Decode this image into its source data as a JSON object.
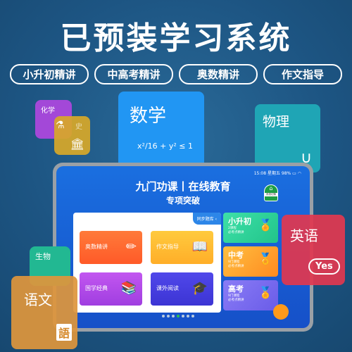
{
  "headline": "已预装学习系统",
  "pills": [
    "小升初精讲",
    "中高考精讲",
    "奥数精讲",
    "作文指导"
  ],
  "subjects": {
    "chemistry": "化学",
    "history": "史",
    "math": "数学",
    "math_formula": "x²/16 + y² ≤ 1",
    "physics": "物理",
    "english": "英语",
    "english_badge": "Yes",
    "biology": "生物",
    "chinese": "语文",
    "chinese_icon_char": "語"
  },
  "tablet": {
    "status": {
      "time": "15:08",
      "weekday": "星期五",
      "battery": "98%"
    },
    "title": "九门功课丨在线教育",
    "subtitle": "专项突破",
    "home_label": "系统切换",
    "tab_label": "同步题库",
    "tiles": [
      {
        "label": "奥数精讲",
        "color": "#ff6b2e",
        "icon": "ruler-pencil-icon"
      },
      {
        "label": "作文指导",
        "color": "#ffbc2e",
        "icon": "open-book-icon"
      },
      {
        "label": "国学经典",
        "color": "#b44ae8",
        "icon": "books-icon"
      },
      {
        "label": "课外阅读",
        "color": "#4a3fe0",
        "icon": "graduation-cap-icon"
      }
    ],
    "levels": [
      {
        "name": "小升初",
        "courses": "2课程",
        "desc": "必考点精讲",
        "color": "#2ed39a"
      },
      {
        "name": "中考",
        "courses": "9门课程",
        "desc": "必考点精讲",
        "color": "#ffa030"
      },
      {
        "name": "高考",
        "courses": "9门课程",
        "desc": "必考点精讲",
        "color": "#7a6cf0"
      }
    ],
    "page_dots": 7,
    "active_dot": 3
  }
}
